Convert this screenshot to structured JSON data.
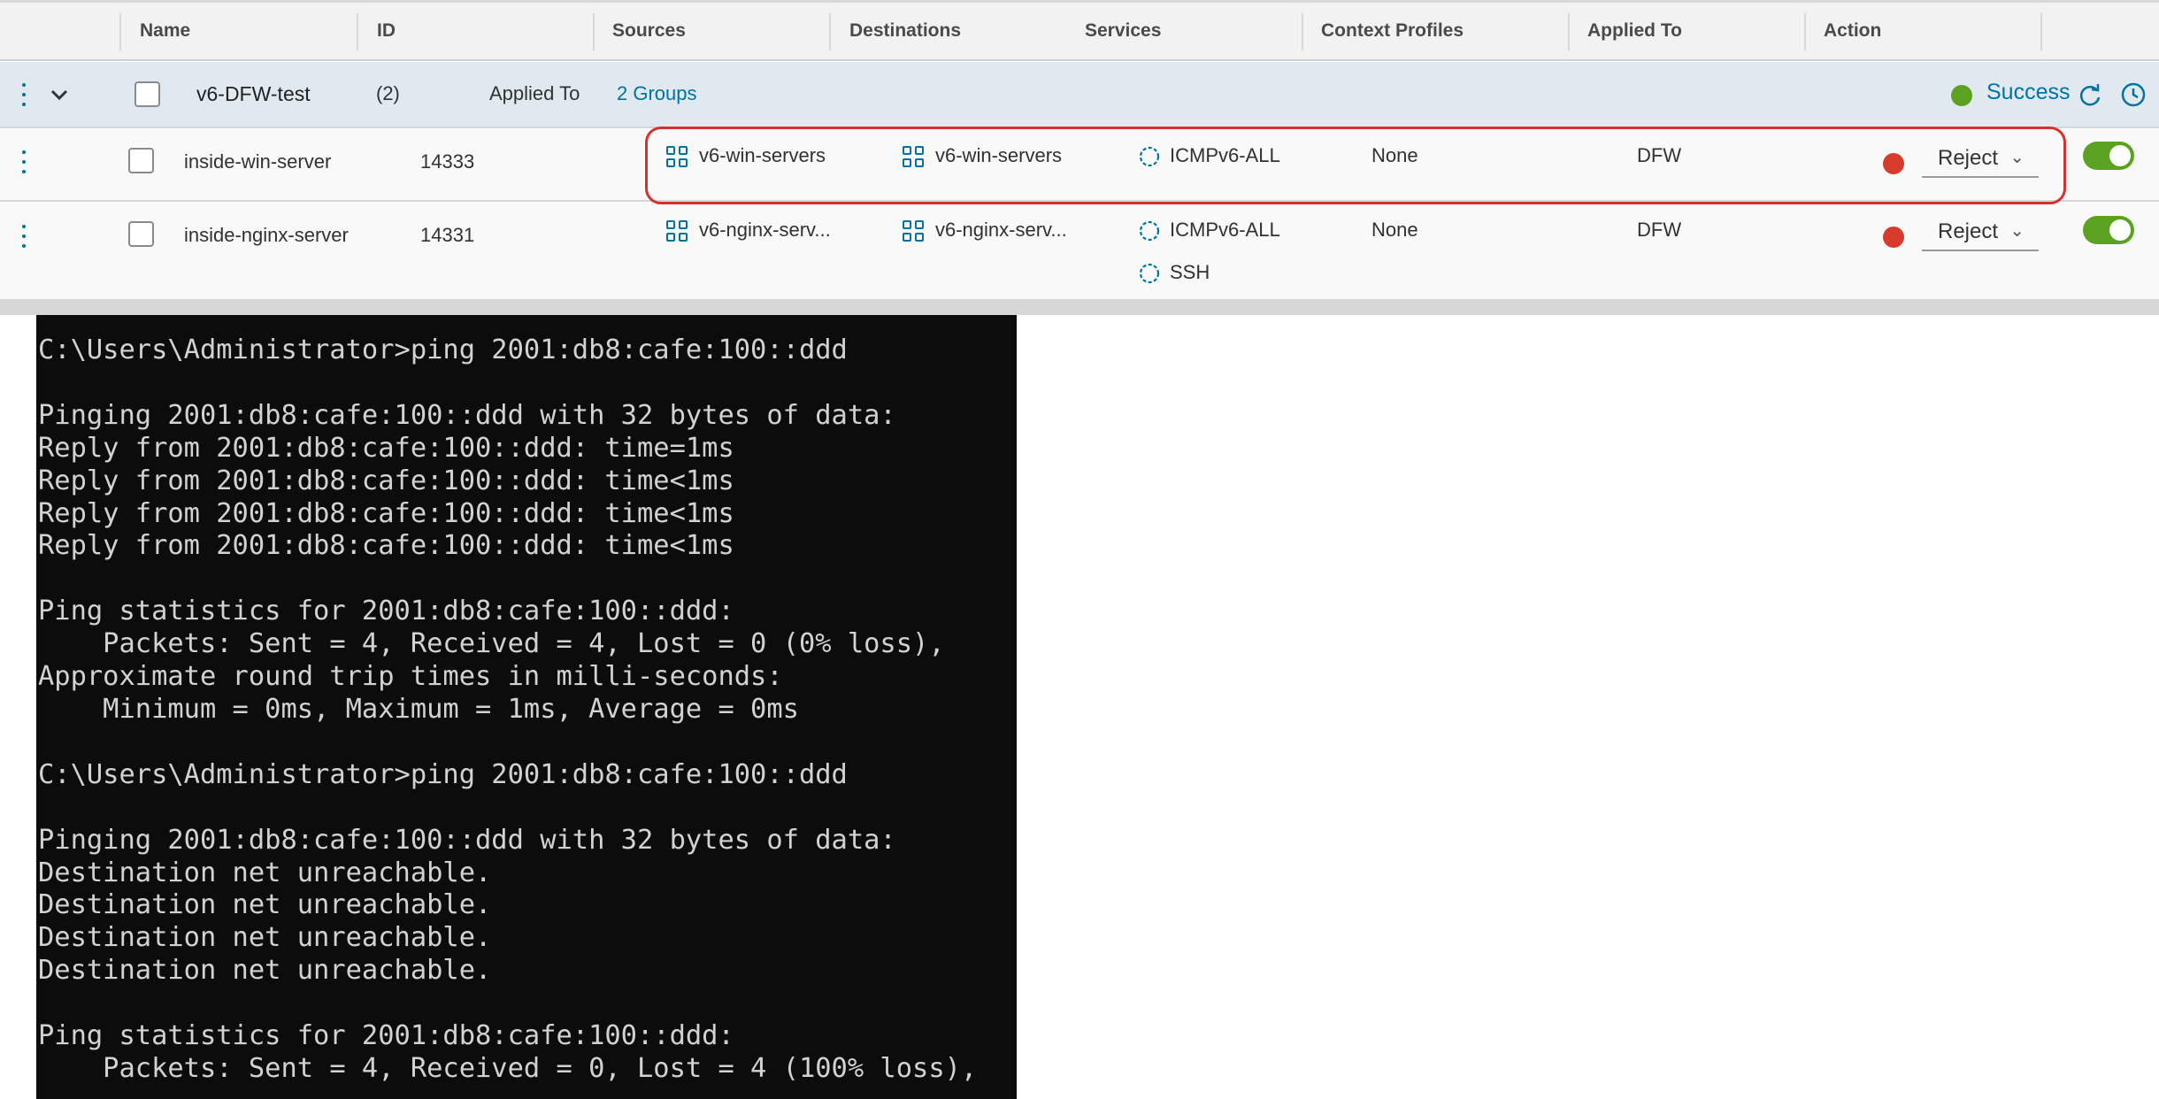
{
  "table": {
    "columns": [
      "Name",
      "ID",
      "Sources",
      "Destinations",
      "Services",
      "Context Profiles",
      "Applied To",
      "Action"
    ],
    "policy": {
      "name": "v6-DFW-test",
      "count": "(2)",
      "applied_to_label": "Applied To",
      "applied_to_value": "2 Groups",
      "status": "Success"
    },
    "rules": [
      {
        "name": "inside-win-server",
        "id": "14333",
        "source": "v6-win-servers",
        "destination": "v6-win-servers",
        "services": [
          "ICMPv6-ALL"
        ],
        "context_profiles": "None",
        "applied_to": "DFW",
        "action": "Reject",
        "enabled": true
      },
      {
        "name": "inside-nginx-server",
        "id": "14331",
        "source": "v6-nginx-serv...",
        "destination": "v6-nginx-serv...",
        "services": [
          "ICMPv6-ALL",
          "SSH"
        ],
        "context_profiles": "None",
        "applied_to": "DFW",
        "action": "Reject",
        "enabled": true
      }
    ]
  },
  "terminal": {
    "lines": [
      "C:\\Users\\Administrator>ping 2001:db8:cafe:100::ddd",
      "",
      "Pinging 2001:db8:cafe:100::ddd with 32 bytes of data:",
      "Reply from 2001:db8:cafe:100::ddd: time=1ms",
      "Reply from 2001:db8:cafe:100::ddd: time<1ms",
      "Reply from 2001:db8:cafe:100::ddd: time<1ms",
      "Reply from 2001:db8:cafe:100::ddd: time<1ms",
      "",
      "Ping statistics for 2001:db8:cafe:100::ddd:",
      "    Packets: Sent = 4, Received = 4, Lost = 0 (0% loss),",
      "Approximate round trip times in milli-seconds:",
      "    Minimum = 0ms, Maximum = 1ms, Average = 0ms",
      "",
      "C:\\Users\\Administrator>ping 2001:db8:cafe:100::ddd",
      "",
      "Pinging 2001:db8:cafe:100::ddd with 32 bytes of data:",
      "Destination net unreachable.",
      "Destination net unreachable.",
      "Destination net unreachable.",
      "Destination net unreachable.",
      "",
      "Ping statistics for 2001:db8:cafe:100::ddd:",
      "    Packets: Sent = 4, Received = 0, Lost = 4 (100% loss),"
    ]
  },
  "colors": {
    "accent": "#0072a3",
    "reject": "#d63b2b",
    "success": "#5aa220",
    "highlight": "#d7312b",
    "terminal_bg": "#0c0c0c"
  }
}
